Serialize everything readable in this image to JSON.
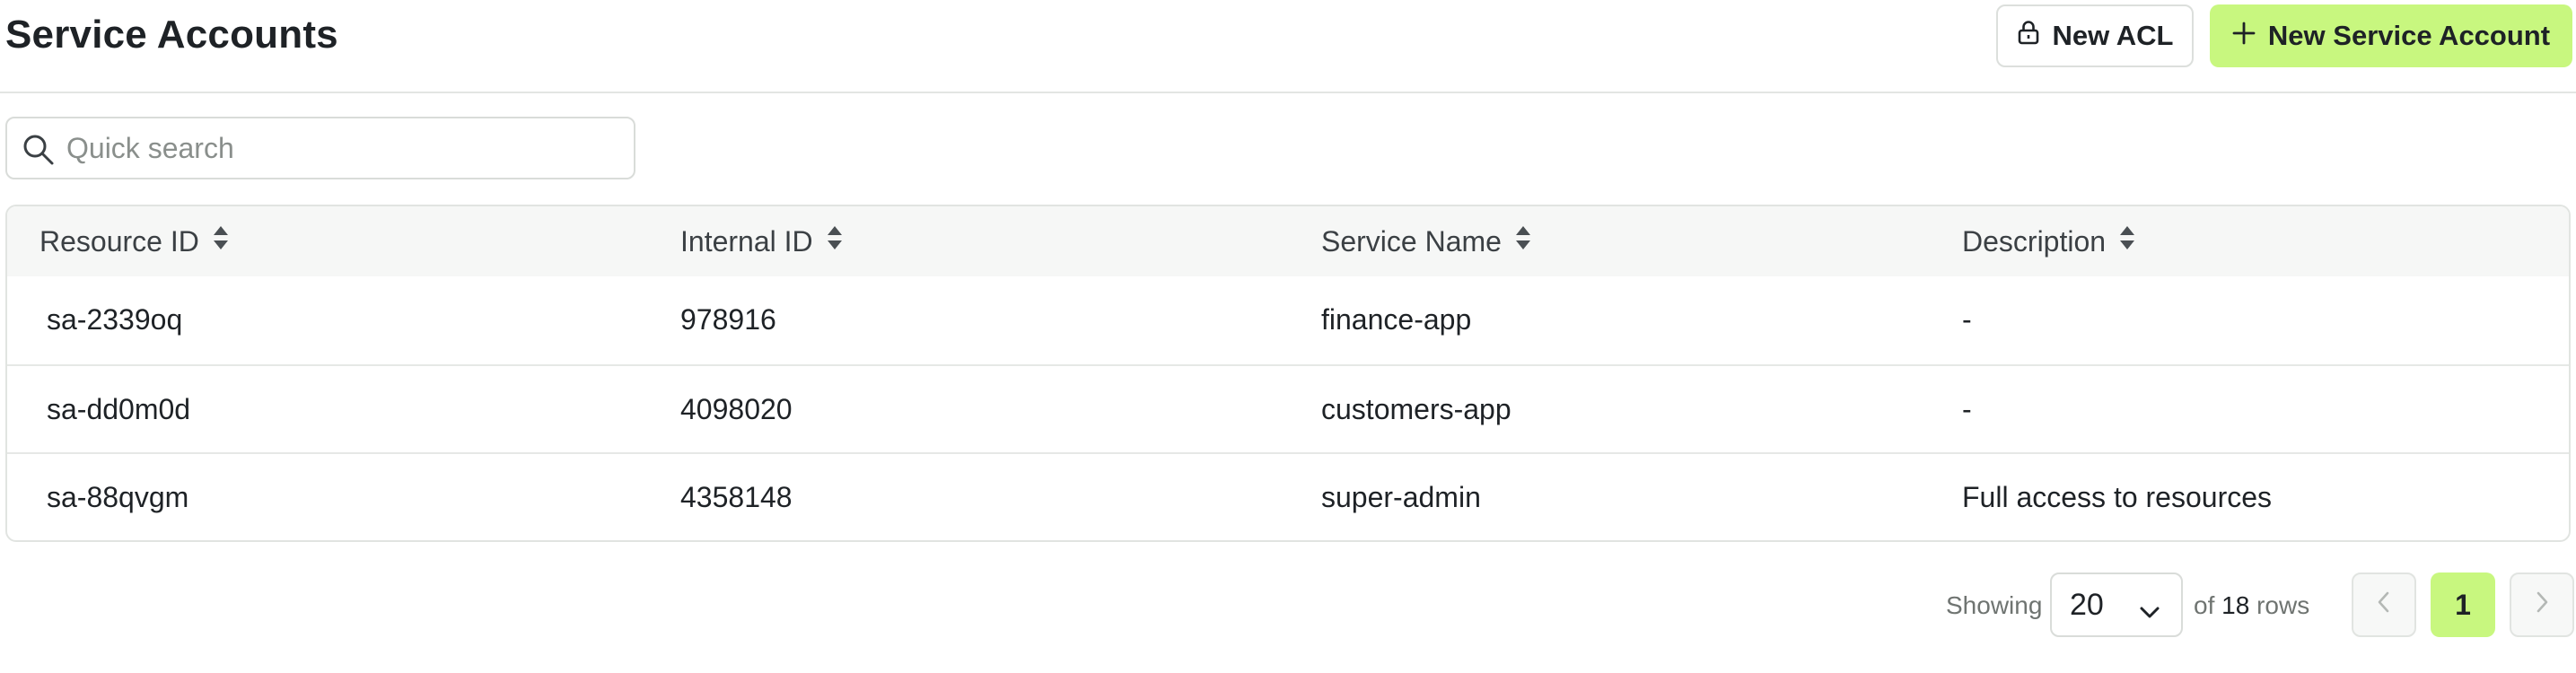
{
  "header": {
    "title": "Service Accounts",
    "new_acl_label": "New ACL",
    "new_service_account_label": "New Service Account"
  },
  "search": {
    "placeholder": "Quick search",
    "value": ""
  },
  "table": {
    "columns": [
      "Resource ID",
      "Internal ID",
      "Service Name",
      "Description"
    ],
    "rows": [
      {
        "resource_id": "sa-2339oq",
        "internal_id": "978916",
        "service_name": "finance-app",
        "description": "-"
      },
      {
        "resource_id": "sa-dd0m0d",
        "internal_id": "4098020",
        "service_name": "customers-app",
        "description": "-"
      },
      {
        "resource_id": "sa-88qvgm",
        "internal_id": "4358148",
        "service_name": "super-admin",
        "description": "Full access to resources"
      }
    ]
  },
  "pagination": {
    "showing_label": "Showing",
    "page_size": "20",
    "of_label": "of",
    "total_rows": "18",
    "rows_label": "rows",
    "current_page": "1"
  },
  "colors": {
    "accent": "#c8f77f",
    "border": "#e1e4e1",
    "header_bg": "#f6f7f6"
  },
  "icons": [
    "lock-icon",
    "plus-icon",
    "search-icon",
    "sort-icon",
    "chevron-down-icon",
    "chevron-left-icon",
    "chevron-right-icon"
  ]
}
